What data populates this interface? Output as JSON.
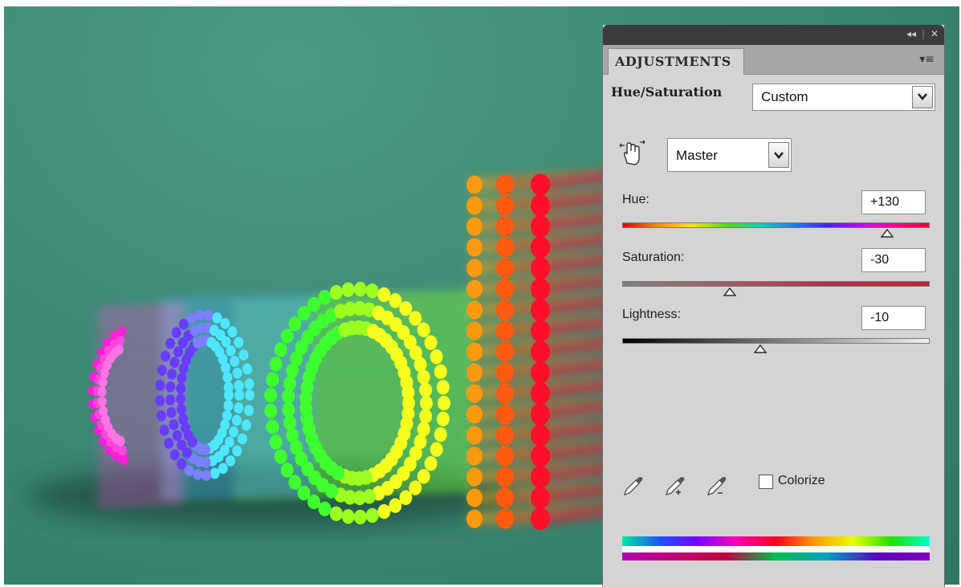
{
  "panel": {
    "tab_label": "ADJUSTMENTS",
    "adjustment_name": "Hue/Saturation",
    "preset": "Custom",
    "channel": "Master",
    "controls": {
      "hue": {
        "label": "Hue:",
        "value": "+130",
        "min": -180,
        "max": 180,
        "current": 130
      },
      "saturation": {
        "label": "Saturation:",
        "value": "-30",
        "min": -100,
        "max": 100,
        "current": -30
      },
      "lightness": {
        "label": "Lightness:",
        "value": "-10",
        "min": -100,
        "max": 100,
        "current": -10
      }
    },
    "colorize_label": "Colorize",
    "colorize_checked": false,
    "icons": [
      "collapse-icon",
      "close-icon",
      "panel-menu-icon",
      "target-adjust-hand-icon",
      "eyedropper-icon",
      "eyedropper-add-icon",
      "eyedropper-subtract-icon"
    ]
  },
  "colors": {
    "canvas_bg": "#3f8a76",
    "panel_bg": "#d4d4d4",
    "titlebar": "#3b3b3b"
  }
}
